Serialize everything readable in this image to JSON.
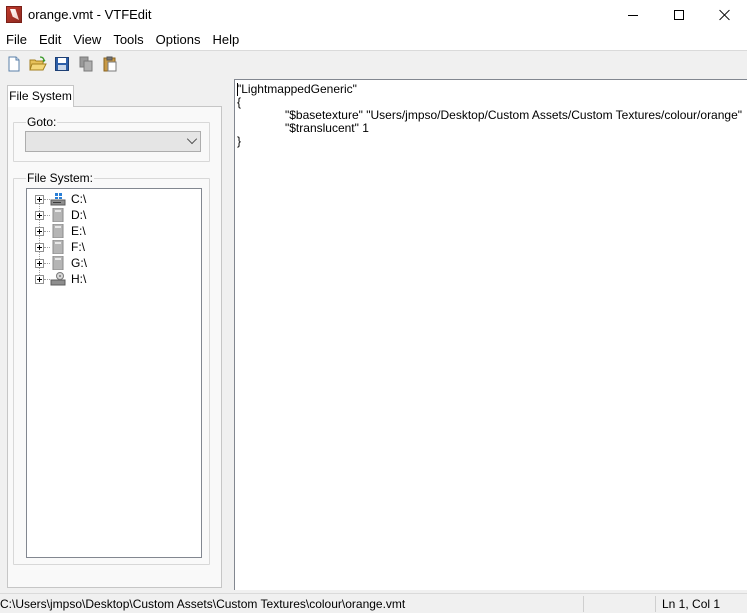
{
  "window": {
    "title": "orange.vmt - VTFEdit"
  },
  "menu": {
    "items": [
      "File",
      "Edit",
      "View",
      "Tools",
      "Options",
      "Help"
    ]
  },
  "toolbar": {
    "icons": [
      "new-file-icon",
      "open-folder-icon",
      "save-disk-icon",
      "copy-icon",
      "paste-icon"
    ]
  },
  "left_panel": {
    "tab_label": "File System",
    "goto_label": "Goto:",
    "goto_value": "",
    "filesystem_label": "File System:",
    "drives": [
      {
        "label": "C:\\",
        "icon": "system-drive-icon"
      },
      {
        "label": "D:\\",
        "icon": "removable-drive-icon"
      },
      {
        "label": "E:\\",
        "icon": "removable-drive-icon"
      },
      {
        "label": "F:\\",
        "icon": "removable-drive-icon"
      },
      {
        "label": "G:\\",
        "icon": "removable-drive-icon"
      },
      {
        "label": "H:\\",
        "icon": "optical-drive-icon"
      }
    ]
  },
  "editor": {
    "lines": [
      "\"LightmappedGeneric\"",
      "{",
      "\t\"$basetexture\" \"Users/jmpso/Desktop/Custom Assets/Custom Textures/colour/orange\"",
      "\t\"$translucent\" 1",
      "}"
    ]
  },
  "status": {
    "path": "C:\\Users\\jmpso\\Desktop\\Custom Assets\\Custom Textures\\colour\\orange.vmt",
    "position": "Ln 1, Col 1"
  }
}
